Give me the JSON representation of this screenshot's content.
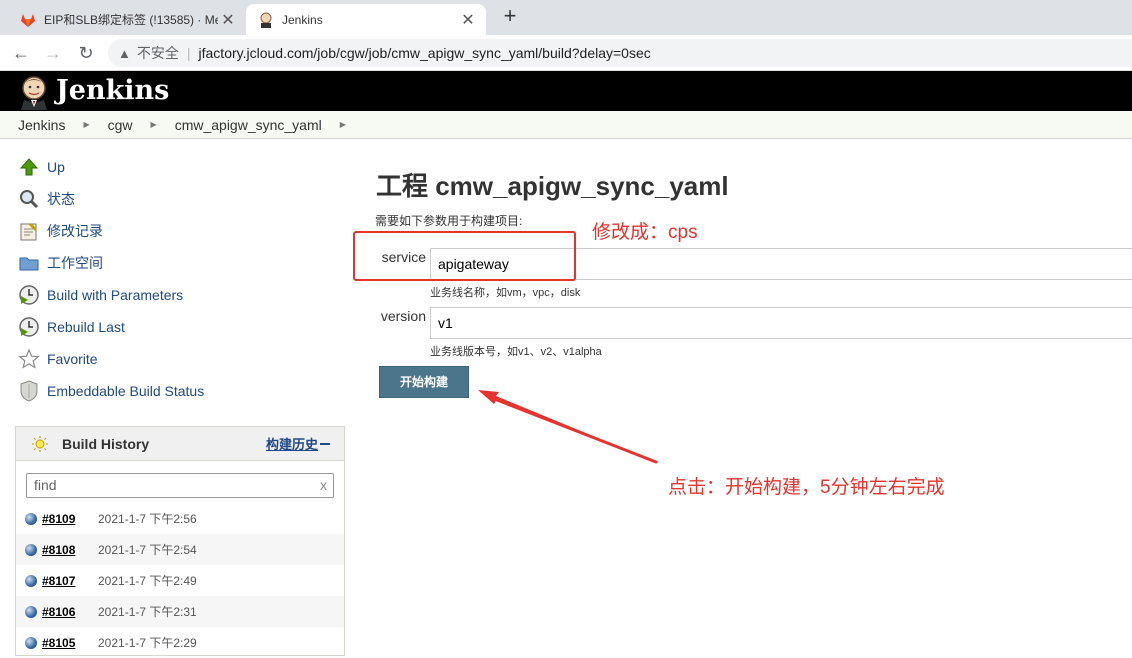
{
  "browser": {
    "tabs": [
      {
        "title": "EIP和SLB绑定标签 (!13585) · Me",
        "active": false
      },
      {
        "title": "Jenkins",
        "active": true
      }
    ],
    "insecure_label": "不安全",
    "url": "jfactory.jcloud.com/job/cgw/job/cmw_apigw_sync_yaml/build?delay=0sec"
  },
  "header": {
    "title": "Jenkins"
  },
  "breadcrumb": [
    "Jenkins",
    "cgw",
    "cmw_apigw_sync_yaml"
  ],
  "sidebar": {
    "tasks": [
      {
        "label": "Up",
        "icon": "up-arrow-icon"
      },
      {
        "label": "状态",
        "icon": "magnifier-icon"
      },
      {
        "label": "修改记录",
        "icon": "notepad-icon"
      },
      {
        "label": "工作空间",
        "icon": "folder-icon"
      },
      {
        "label": "Build with Parameters",
        "icon": "clock-play-icon"
      },
      {
        "label": "Rebuild Last",
        "icon": "clock-play-icon"
      },
      {
        "label": "Favorite",
        "icon": "star-icon"
      },
      {
        "label": "Embeddable Build Status",
        "icon": "shield-icon"
      }
    ]
  },
  "build_history": {
    "title": "Build History",
    "trend_link": "构建历史",
    "search_placeholder": "find",
    "builds": [
      {
        "number": "#8109",
        "date": "2021-1-7 下午2:56"
      },
      {
        "number": "#8108",
        "date": "2021-1-7 下午2:54"
      },
      {
        "number": "#8107",
        "date": "2021-1-7 下午2:49"
      },
      {
        "number": "#8106",
        "date": "2021-1-7 下午2:31"
      },
      {
        "number": "#8105",
        "date": "2021-1-7 下午2:29"
      }
    ]
  },
  "main": {
    "title": "工程 cmw_apigw_sync_yaml",
    "description": "需要如下参数用于构建项目:",
    "params": [
      {
        "name": "service",
        "value": "apigateway",
        "help": "业务线名称，如vm，vpc，disk"
      },
      {
        "name": "version",
        "value": "v1",
        "help": "业务线版本号，如v1、v2、v1alpha"
      }
    ],
    "submit_label": "开始构建"
  },
  "annotations": {
    "note_change": "修改成：cps",
    "note_click": "点击：开始构建，5分钟左右完成",
    "color": "#e8322d"
  }
}
